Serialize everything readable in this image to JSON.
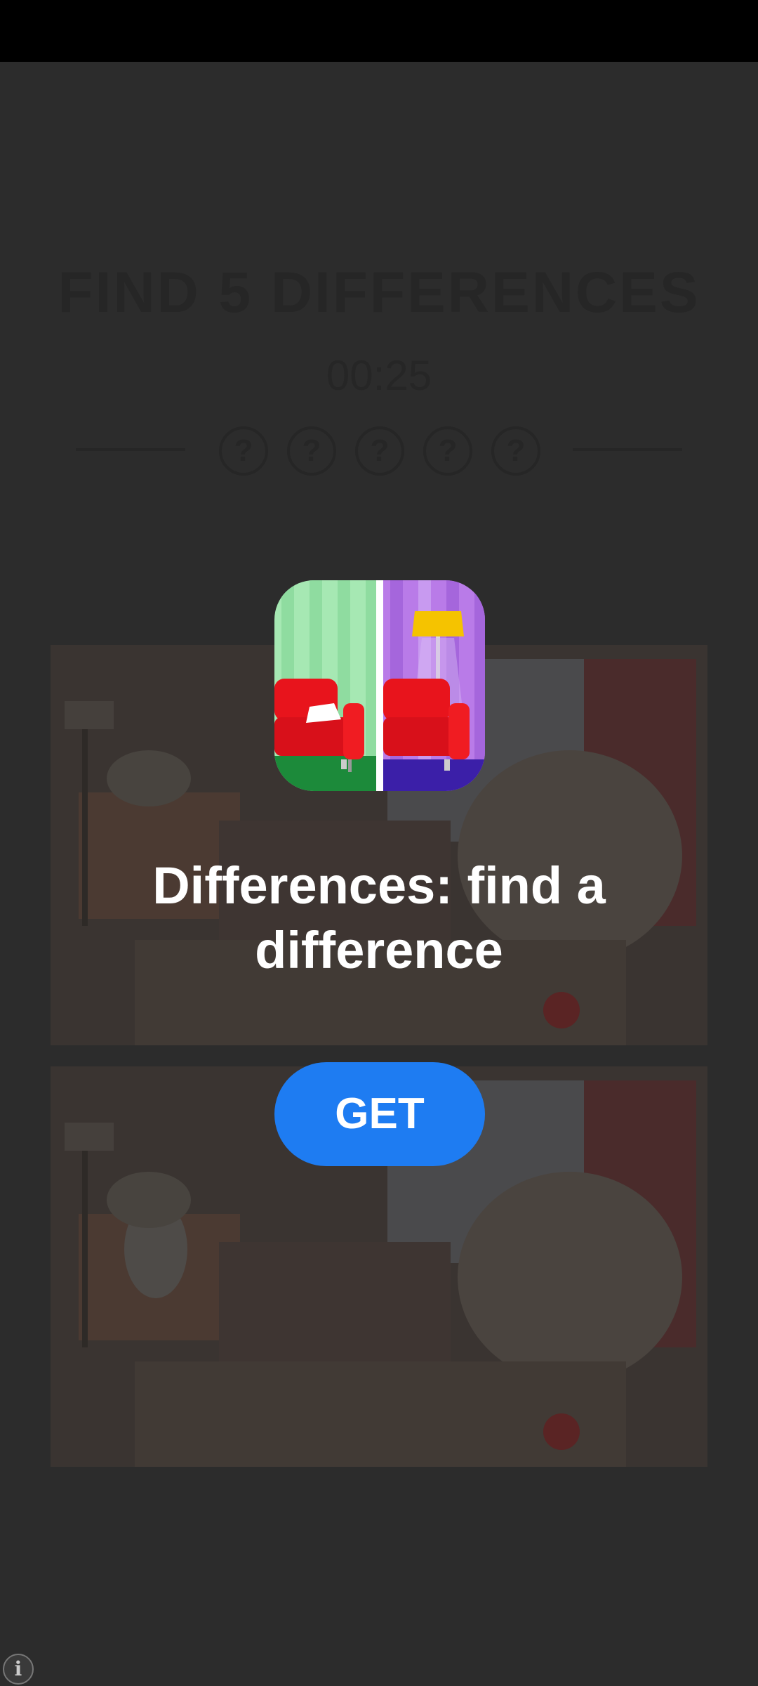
{
  "game": {
    "title": "FIND 5 DIFFERENCES",
    "timer": "00:25",
    "hints": [
      "?",
      "?",
      "?",
      "?",
      "?"
    ]
  },
  "ad": {
    "app_name": "Differences: find a difference",
    "get_label": "GET",
    "info_label": "i"
  },
  "colors": {
    "overlay_bg": "#2c2c2c",
    "button": "#1e7cf2",
    "icon_green_wall": "#a6e8b3",
    "icon_purple_wall": "#b97be8",
    "sofa_red": "#e8141c"
  },
  "icons": {
    "info": "info-icon",
    "hint": "question-mark-icon"
  }
}
